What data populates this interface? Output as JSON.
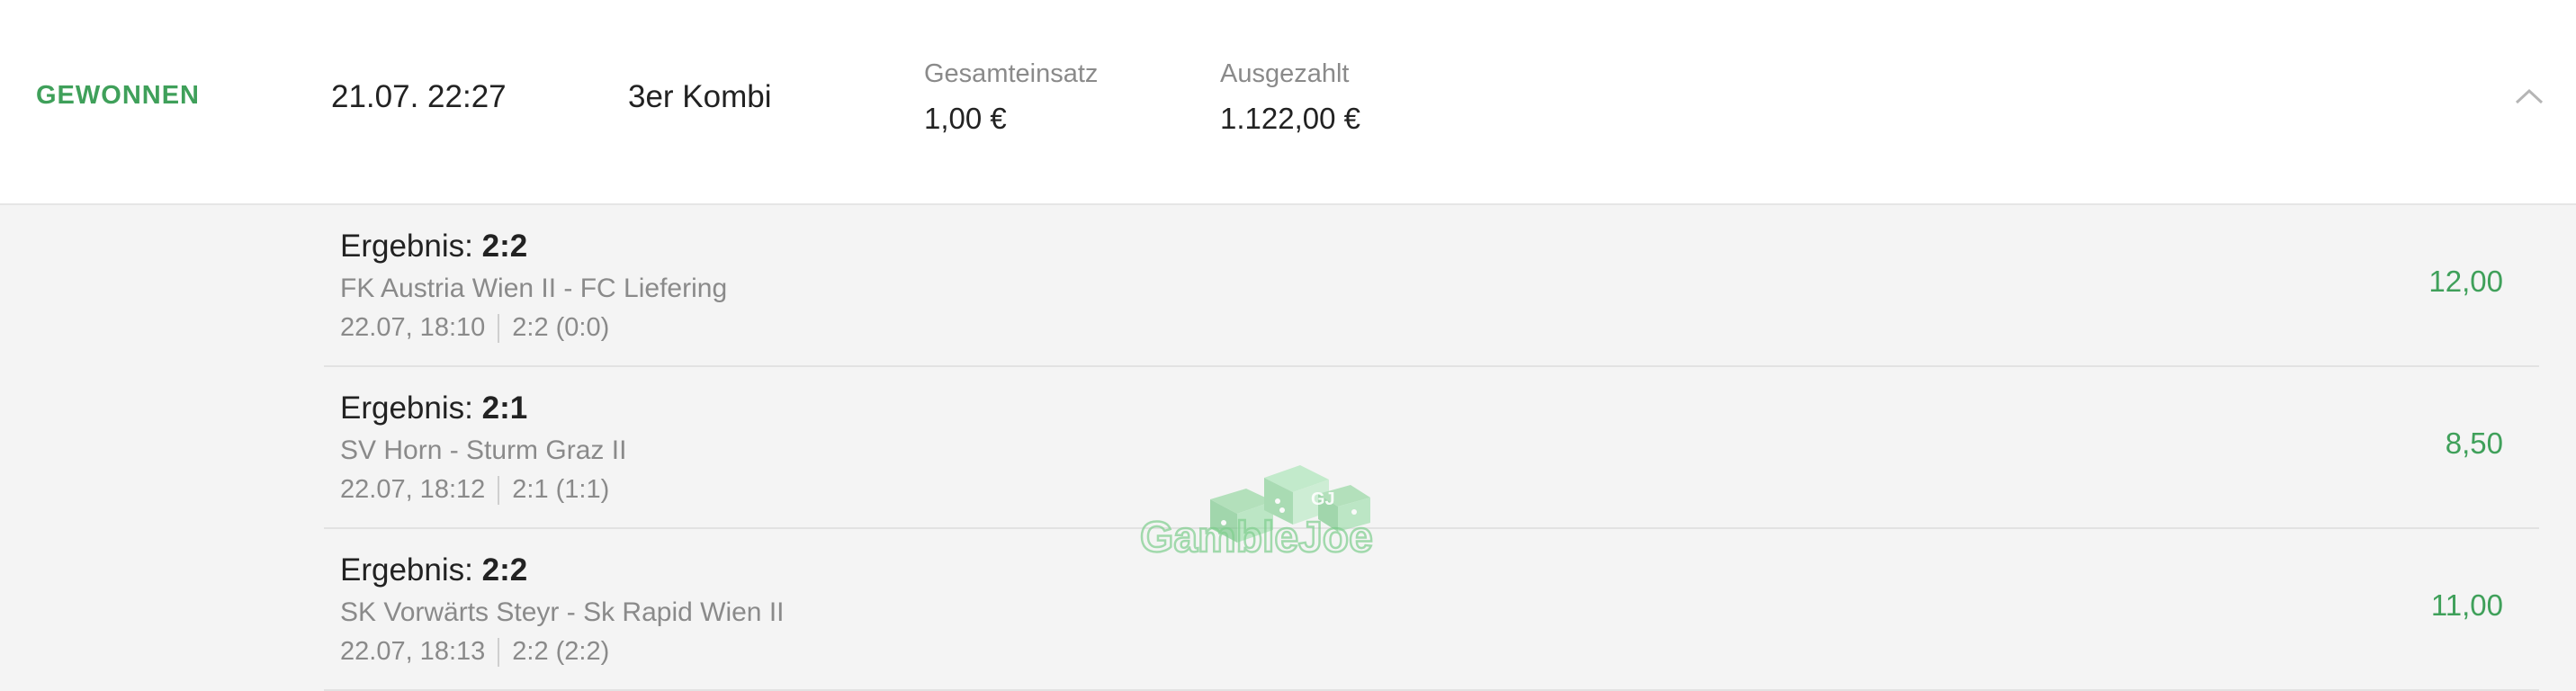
{
  "bet": {
    "status": "GEWONNEN",
    "date": "21.07. 22:27",
    "type": "3er Kombi",
    "stake_label": "Gesamteinsatz",
    "stake_value": "1,00 €",
    "paid_label": "Ausgezahlt",
    "paid_value": "1.122,00 €"
  },
  "selections": [
    {
      "result_label": "Ergebnis:",
      "result": "2:2",
      "match": "FK Austria Wien II - FC Liefering",
      "kickoff": "22.07, 18:10",
      "final": "2:2 (0:0)",
      "odds": "12,00"
    },
    {
      "result_label": "Ergebnis:",
      "result": "2:1",
      "match": "SV Horn - Sturm Graz II",
      "kickoff": "22.07, 18:12",
      "final": "2:1 (1:1)",
      "odds": "8,50"
    },
    {
      "result_label": "Ergebnis:",
      "result": "2:2",
      "match": "SK Vorwärts Steyr - Sk Rapid Wien II",
      "kickoff": "22.07, 18:13",
      "final": "2:2 (2:2)",
      "odds": "11,00"
    }
  ],
  "watermark": {
    "text": "GambleJoe",
    "badge": "GJ"
  },
  "colors": {
    "accent": "#3fa05a",
    "muted": "#8a8a8a",
    "panel": "#f4f4f4"
  },
  "icons": {
    "collapse": "chevron-up-icon"
  }
}
